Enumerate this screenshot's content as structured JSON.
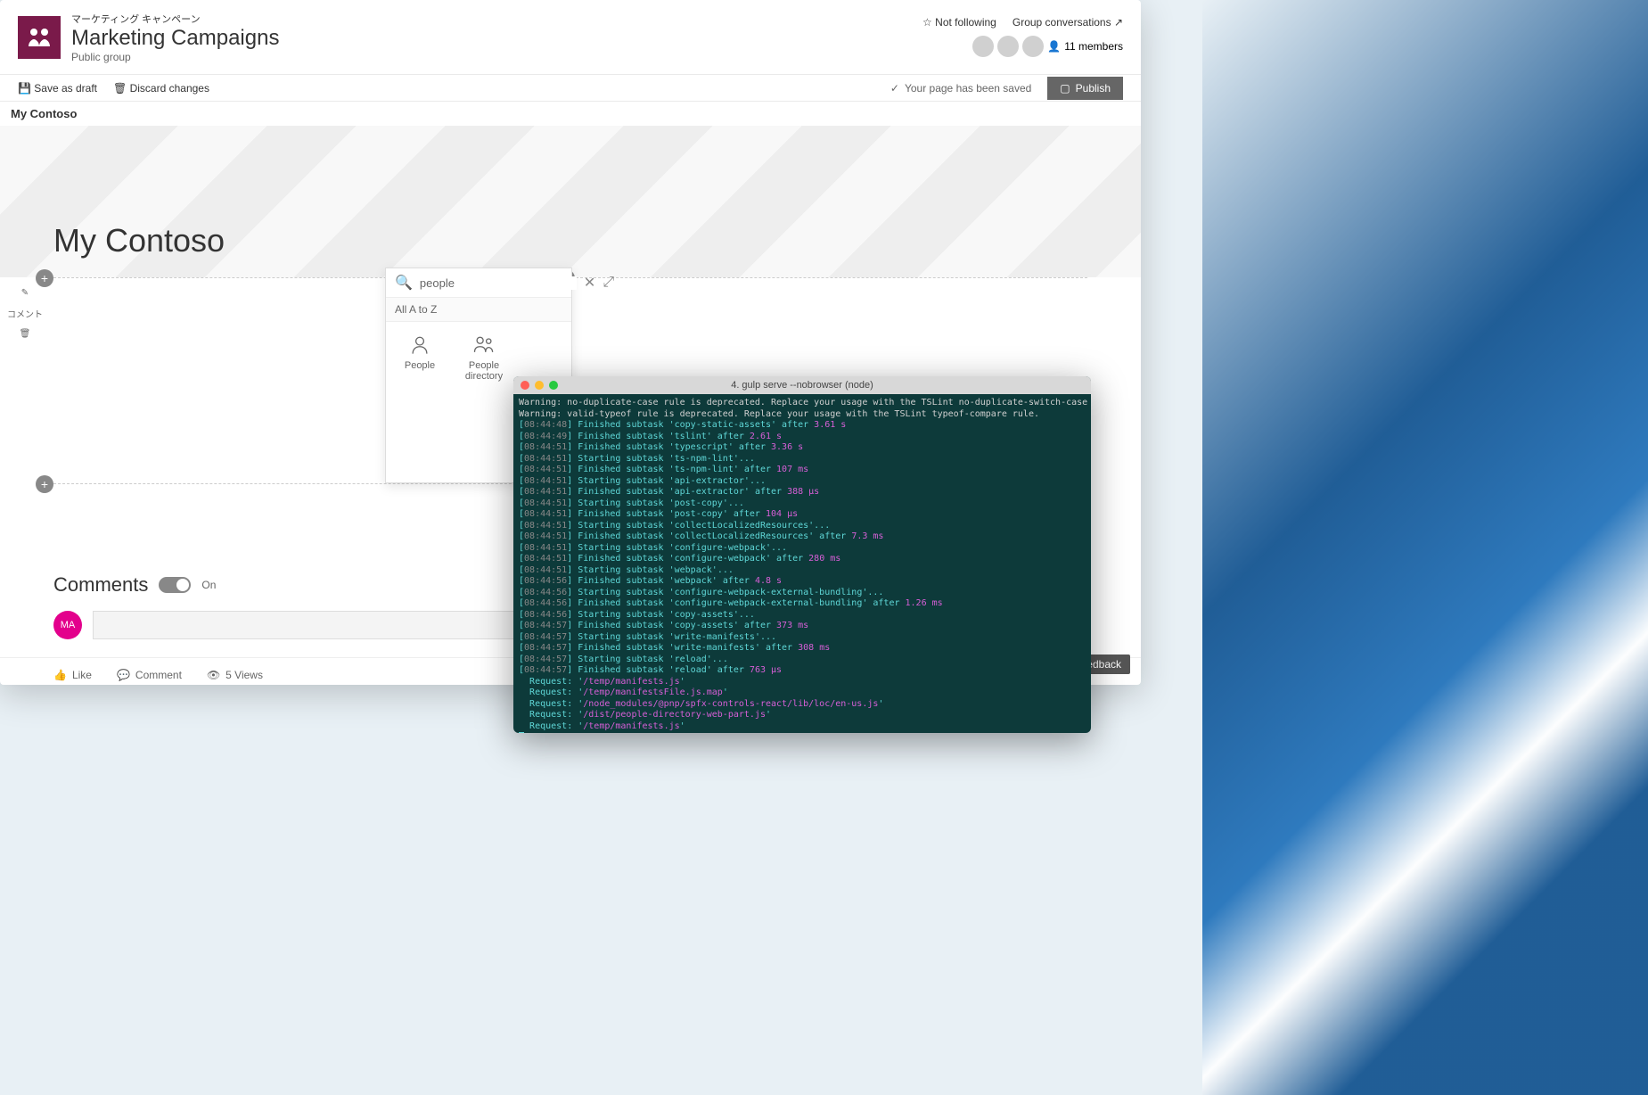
{
  "site": {
    "jp_title": "マーケティング キャンペーン",
    "title": "Marketing Campaigns",
    "subtitle": "Public group"
  },
  "header_right": {
    "not_following": "Not following",
    "group_conv": "Group conversations",
    "members": "11 members"
  },
  "command_bar": {
    "save_draft": "Save as draft",
    "discard": "Discard changes",
    "saved_msg": "Your page has been saved",
    "publish": "Publish"
  },
  "breadcrumb": "My Contoso",
  "hero_title": "My Contoso",
  "side_tool_label": "コメント",
  "toolbox": {
    "search_value": "people",
    "tab": "All A to Z",
    "items": [
      {
        "label": "People"
      },
      {
        "label": "People directory"
      }
    ]
  },
  "comments": {
    "title": "Comments",
    "toggle_label": "On",
    "avatar_initials": "MA"
  },
  "footer": {
    "like": "Like",
    "comment": "Comment",
    "views": "5 Views"
  },
  "feedback": "Feedback",
  "terminal": {
    "title": "4. gulp serve --nobrowser (node)",
    "warnings": [
      "Warning: no-duplicate-case rule is deprecated. Replace your usage with the TSLint no-duplicate-switch-case rule.",
      "Warning: valid-typeof rule is deprecated. Replace your usage with the TSLint typeof-compare rule."
    ],
    "lines": [
      {
        "ts": "08:44:48",
        "text": "Finished subtask",
        "task": "copy-static-assets",
        "after": "3.61 s"
      },
      {
        "ts": "08:44:49",
        "text": "Finished subtask",
        "task": "tslint",
        "after": "2.61 s"
      },
      {
        "ts": "08:44:51",
        "text": "Finished subtask",
        "task": "typescript",
        "after": "3.36 s"
      },
      {
        "ts": "08:44:51",
        "text": "Starting subtask",
        "task": "ts-npm-lint",
        "suffix": "..."
      },
      {
        "ts": "08:44:51",
        "text": "Finished subtask",
        "task": "ts-npm-lint",
        "after": "107 ms"
      },
      {
        "ts": "08:44:51",
        "text": "Starting subtask",
        "task": "api-extractor",
        "suffix": "..."
      },
      {
        "ts": "08:44:51",
        "text": "Finished subtask",
        "task": "api-extractor",
        "after": "388 μs"
      },
      {
        "ts": "08:44:51",
        "text": "Starting subtask",
        "task": "post-copy",
        "suffix": "..."
      },
      {
        "ts": "08:44:51",
        "text": "Finished subtask",
        "task": "post-copy",
        "after": "104 μs"
      },
      {
        "ts": "08:44:51",
        "text": "Starting subtask",
        "task": "collectLocalizedResources",
        "suffix": "..."
      },
      {
        "ts": "08:44:51",
        "text": "Finished subtask",
        "task": "collectLocalizedResources",
        "after": "7.3 ms"
      },
      {
        "ts": "08:44:51",
        "text": "Starting subtask",
        "task": "configure-webpack",
        "suffix": "..."
      },
      {
        "ts": "08:44:51",
        "text": "Finished subtask",
        "task": "configure-webpack",
        "after": "280 ms"
      },
      {
        "ts": "08:44:51",
        "text": "Starting subtask",
        "task": "webpack",
        "suffix": "..."
      },
      {
        "ts": "08:44:56",
        "text": "Finished subtask",
        "task": "webpack",
        "after": "4.8 s"
      },
      {
        "ts": "08:44:56",
        "text": "Starting subtask",
        "task": "configure-webpack-external-bundling",
        "suffix": "..."
      },
      {
        "ts": "08:44:56",
        "text": "Finished subtask",
        "task": "configure-webpack-external-bundling",
        "after": "1.26 ms"
      },
      {
        "ts": "08:44:56",
        "text": "Starting subtask",
        "task": "copy-assets",
        "suffix": "..."
      },
      {
        "ts": "08:44:57",
        "text": "Finished subtask",
        "task": "copy-assets",
        "after": "373 ms"
      },
      {
        "ts": "08:44:57",
        "text": "Starting subtask",
        "task": "write-manifests",
        "suffix": "..."
      },
      {
        "ts": "08:44:57",
        "text": "Finished subtask",
        "task": "write-manifests",
        "after": "308 ms"
      },
      {
        "ts": "08:44:57",
        "text": "Starting subtask",
        "task": "reload",
        "suffix": "..."
      },
      {
        "ts": "08:44:57",
        "text": "Finished subtask",
        "task": "reload",
        "after": "763 μs"
      }
    ],
    "requests": [
      "/temp/manifests.js",
      "/temp/manifestsFile.js.map",
      "/node_modules/@pnp/spfx-controls-react/lib/loc/en-us.js",
      "/dist/people-directory-web-part.js",
      "/temp/manifests.js"
    ]
  }
}
